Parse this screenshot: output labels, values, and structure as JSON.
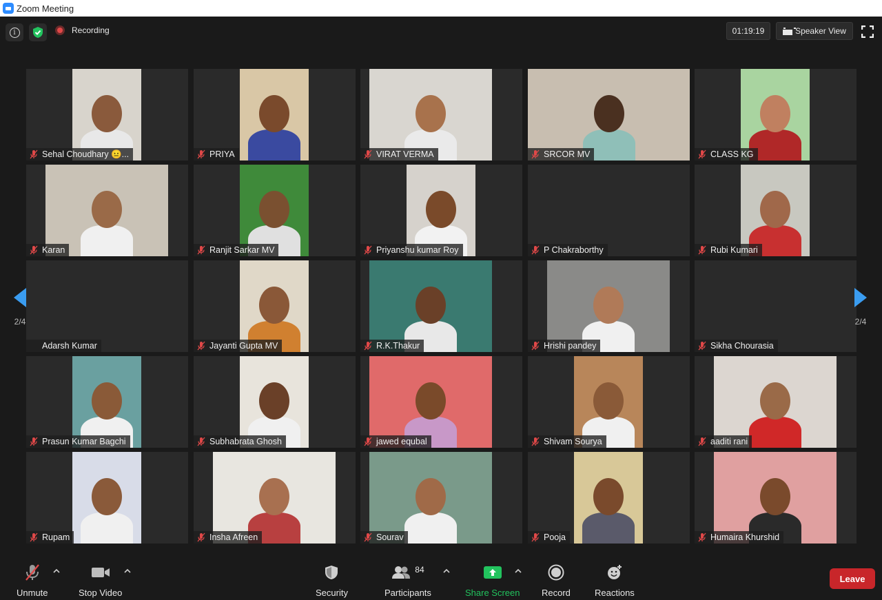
{
  "window": {
    "title": "Zoom Meeting"
  },
  "topbar": {
    "recording_label": "Recording",
    "timer": "01:19:19",
    "view_label": "Speaker View"
  },
  "pagination": {
    "left_label": "2/4",
    "right_label": "2/4"
  },
  "participants": [
    {
      "name": "Sehal Choudhary 😐...",
      "muted": true,
      "video": true
    },
    {
      "name": "PRIYA",
      "muted": true,
      "video": true
    },
    {
      "name": "VIRAT VERMA",
      "muted": true,
      "video": true
    },
    {
      "name": "SRCOR MV",
      "muted": true,
      "video": true
    },
    {
      "name": "CLASS KG",
      "muted": true,
      "video": true
    },
    {
      "name": "Karan",
      "muted": true,
      "video": true
    },
    {
      "name": "Ranjit Sarkar MV",
      "muted": true,
      "video": true
    },
    {
      "name": "Priyanshu kumar Roy",
      "muted": true,
      "video": true
    },
    {
      "name": "P Chakraborthy",
      "muted": true,
      "video": false
    },
    {
      "name": "Rubi Kumari",
      "muted": true,
      "video": true
    },
    {
      "name": "Adarsh Kumar",
      "muted": false,
      "video": false
    },
    {
      "name": "Jayanti Gupta MV",
      "muted": true,
      "video": true
    },
    {
      "name": "R.K.Thakur",
      "muted": true,
      "video": true
    },
    {
      "name": "Hrishi pandey",
      "muted": true,
      "video": true
    },
    {
      "name": "Sikha Chourasia",
      "muted": true,
      "video": false
    },
    {
      "name": "Prasun Kumar Bagchi",
      "muted": true,
      "video": true
    },
    {
      "name": "Subhabrata Ghosh",
      "muted": true,
      "video": true
    },
    {
      "name": "jawed equbal",
      "muted": true,
      "video": true
    },
    {
      "name": "Shivam Sourya",
      "muted": true,
      "video": true
    },
    {
      "name": "aaditi rani",
      "muted": true,
      "video": true
    },
    {
      "name": "Rupam",
      "muted": true,
      "video": true
    },
    {
      "name": "Insha Afreen",
      "muted": true,
      "video": true
    },
    {
      "name": "Sourav",
      "muted": true,
      "video": true
    },
    {
      "name": "Pooja",
      "muted": true,
      "video": true
    },
    {
      "name": "Humaira Khurshid",
      "muted": true,
      "video": true
    }
  ],
  "toolbar": {
    "unmute_label": "Unmute",
    "stop_video_label": "Stop Video",
    "security_label": "Security",
    "participants_label": "Participants",
    "participants_count": "84",
    "share_screen_label": "Share Screen",
    "record_label": "Record",
    "reactions_label": "Reactions",
    "leave_label": "Leave"
  },
  "colors": {
    "accent_blue": "#3a9cf0",
    "share_green": "#22c35e",
    "leave_red": "#c8262a",
    "mute_red": "#e04848"
  }
}
